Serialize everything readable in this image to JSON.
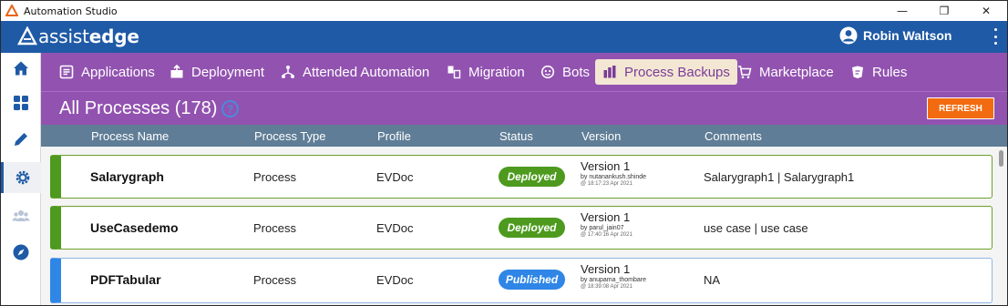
{
  "window": {
    "title": "Automation Studio",
    "minimize": "—",
    "maximize": "❐",
    "close": "✕"
  },
  "brand": {
    "logo_part1": "assist",
    "logo_part2": "edge",
    "user_name": "Robin Waltson"
  },
  "sidebar": {
    "items": [
      {
        "icon": "home-icon"
      },
      {
        "icon": "dashboard-icon"
      },
      {
        "icon": "pencil-icon"
      },
      {
        "icon": "gear-icon",
        "active": true
      },
      {
        "icon": "team-icon",
        "disabled": true
      },
      {
        "icon": "compass-icon"
      }
    ]
  },
  "nav": {
    "tabs": [
      {
        "label": "Applications",
        "icon": "applications-icon"
      },
      {
        "label": "Deployment",
        "icon": "deployment-icon"
      },
      {
        "label": "Attended Automation",
        "icon": "attended-automation-icon"
      },
      {
        "label": "Migration",
        "icon": "migration-icon"
      },
      {
        "label": "Bots",
        "icon": "bot-icon"
      },
      {
        "label": "Process Backups",
        "icon": "process-backups-icon",
        "active": true
      },
      {
        "label": "Marketplace",
        "icon": "cart-icon"
      },
      {
        "label": "Rules",
        "icon": "rules-icon"
      }
    ]
  },
  "header": {
    "title": "All Processes (178)",
    "help": "?",
    "refresh_label": "REFRESH"
  },
  "table": {
    "columns": [
      "Process Name",
      "Process Type",
      "Profile",
      "Status",
      "Version",
      "Comments"
    ],
    "rows": [
      {
        "name": "Salarygraph",
        "type": "Process",
        "profile": "EVDoc",
        "status": "Deployed",
        "version": "Version 1",
        "by": "by nutanankush.shinde",
        "at": "@ 18:17:23 Apr 2021",
        "comments": "Salarygraph1 | Salarygraph1"
      },
      {
        "name": "UseCasedemo",
        "type": "Process",
        "profile": "EVDoc",
        "status": "Deployed",
        "version": "Version 1",
        "by": "by parul_jain07",
        "at": "@ 17:40:16 Apr 2021",
        "comments": "use case | use case"
      },
      {
        "name": "PDFTabular",
        "type": "Process",
        "profile": "EVDoc",
        "status": "Published",
        "version": "Version 1",
        "by": "by anupama_thombare",
        "at": "@ 18:39:08 Apr 2021",
        "comments": "NA"
      }
    ]
  },
  "colors": {
    "brand_blue": "#1f5aa6",
    "nav_purple": "#9252b0",
    "deployed_green": "#4d9a1e",
    "published_blue": "#2f86e6",
    "refresh_orange": "#f26b10",
    "column_header": "#5f7d96"
  }
}
